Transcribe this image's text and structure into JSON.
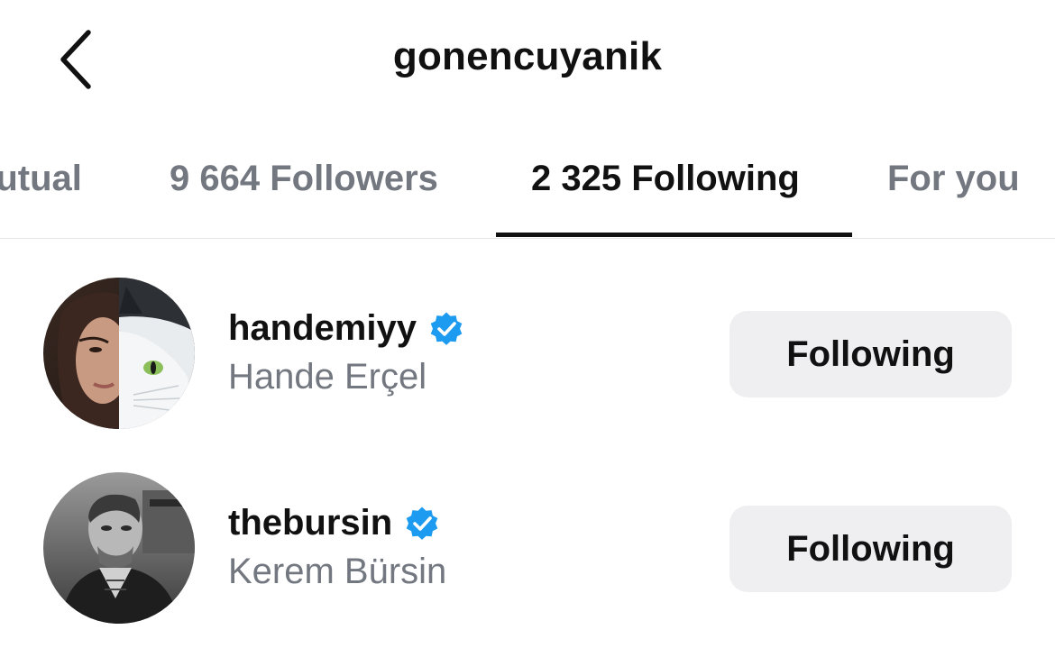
{
  "header": {
    "title": "gonencuyanik",
    "back_icon": "chevron-left-icon"
  },
  "tabs": [
    {
      "label": "Mutual",
      "active": false
    },
    {
      "label": "9 664 Followers",
      "active": false
    },
    {
      "label": "2 325 Following",
      "active": true
    },
    {
      "label": "For you",
      "active": false
    }
  ],
  "users": [
    {
      "username": "handemiyy",
      "full_name": "Hande Erçel",
      "verified": true,
      "button_label": "Following"
    },
    {
      "username": "thebursin",
      "full_name": "Kerem Bürsin",
      "verified": true,
      "button_label": "Following"
    }
  ],
  "colors": {
    "text_primary": "#111111",
    "text_secondary": "#737780",
    "verified_blue": "#1d9bf0",
    "button_bg": "#efeff2",
    "divider": "#e6e6e6"
  }
}
